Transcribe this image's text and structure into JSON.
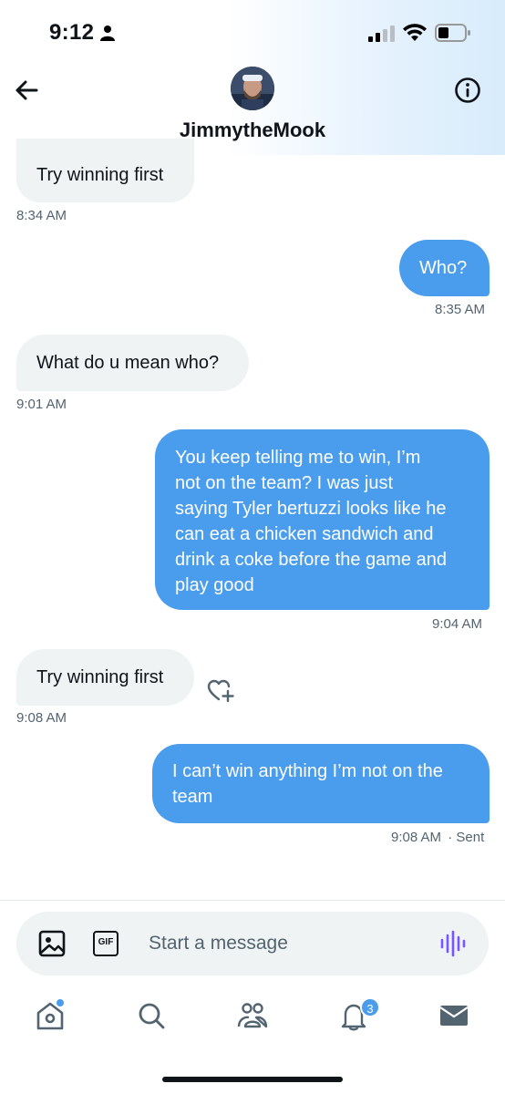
{
  "status_bar": {
    "time": "9:12"
  },
  "header": {
    "contact_name": "JimmytheMook",
    "back_icon": "arrow-left-icon",
    "info_icon": "info-circle-icon"
  },
  "messages": [
    {
      "direction": "incoming",
      "text": "Try winning first",
      "time": "8:34 AM"
    },
    {
      "direction": "outgoing",
      "text": "Who?",
      "time": "8:35 AM"
    },
    {
      "direction": "incoming",
      "text": "What do u mean who?",
      "time": "9:01 AM"
    },
    {
      "direction": "outgoing",
      "lines": [
        "You keep telling me to win, I’m",
        "not on the team? I was just",
        "saying Tyler bertuzzi looks like he",
        "can eat a chicken sandwich and",
        "drink a coke before the game and",
        "play good"
      ],
      "time": "9:04 AM"
    },
    {
      "direction": "incoming",
      "text": "Try winning first",
      "time": "9:08 AM"
    },
    {
      "direction": "outgoing",
      "lines": [
        "I can’t win anything I’m not on the",
        "team"
      ],
      "time": "9:08 AM",
      "status": "· Sent"
    }
  ],
  "composer": {
    "placeholder": "Start a message",
    "gif_label": "GIF"
  },
  "tab_bar": {
    "notifications_badge": "3",
    "accent_color": "#4a9cec"
  }
}
